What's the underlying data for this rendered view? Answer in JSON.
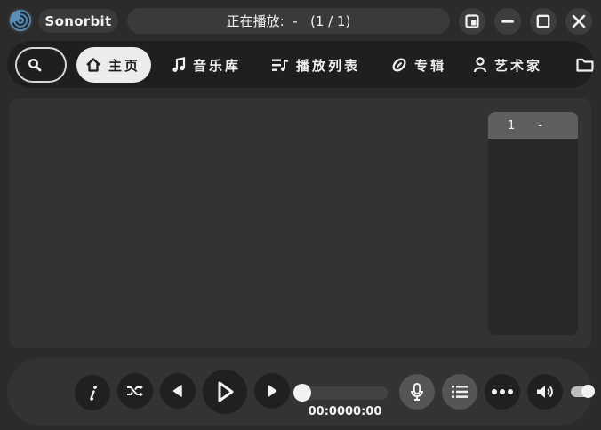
{
  "app": {
    "name": "Sonorbit",
    "now_playing": "正在播放:  -   (1 / 1)"
  },
  "window_controls": {
    "items": [
      "mini-player-icon",
      "minimize-icon",
      "maximize-icon",
      "close-icon"
    ]
  },
  "nav": {
    "search_icon": "search-icon",
    "tabs": [
      {
        "label": "主页",
        "icon": "home-icon",
        "active": true
      },
      {
        "label": "音乐库",
        "icon": "music-note-icon",
        "active": false
      },
      {
        "label": "播放列表",
        "icon": "playlist-icon",
        "active": false
      },
      {
        "label": "专辑",
        "icon": "disc-icon",
        "active": false
      },
      {
        "label": "艺术家",
        "icon": "person-icon",
        "active": false
      },
      {
        "label": "",
        "icon": "folder-icon",
        "active": false
      }
    ]
  },
  "queue": {
    "items": [
      {
        "index": "1",
        "title": "-"
      }
    ]
  },
  "player": {
    "time": "00:0000:00",
    "progress": 0,
    "volume": 1,
    "controls": [
      "info-icon",
      "shuffle-icon",
      "previous-icon",
      "play-icon",
      "next-icon",
      "microphone-icon",
      "queue-list-icon",
      "more-icon",
      "volume-icon"
    ]
  },
  "colors": {
    "background": "#2b2b2b",
    "panel": "#333333",
    "nav_background": "#1f1f1f",
    "active_tab": "#ececec",
    "accent_text": "#f2f2f2"
  }
}
